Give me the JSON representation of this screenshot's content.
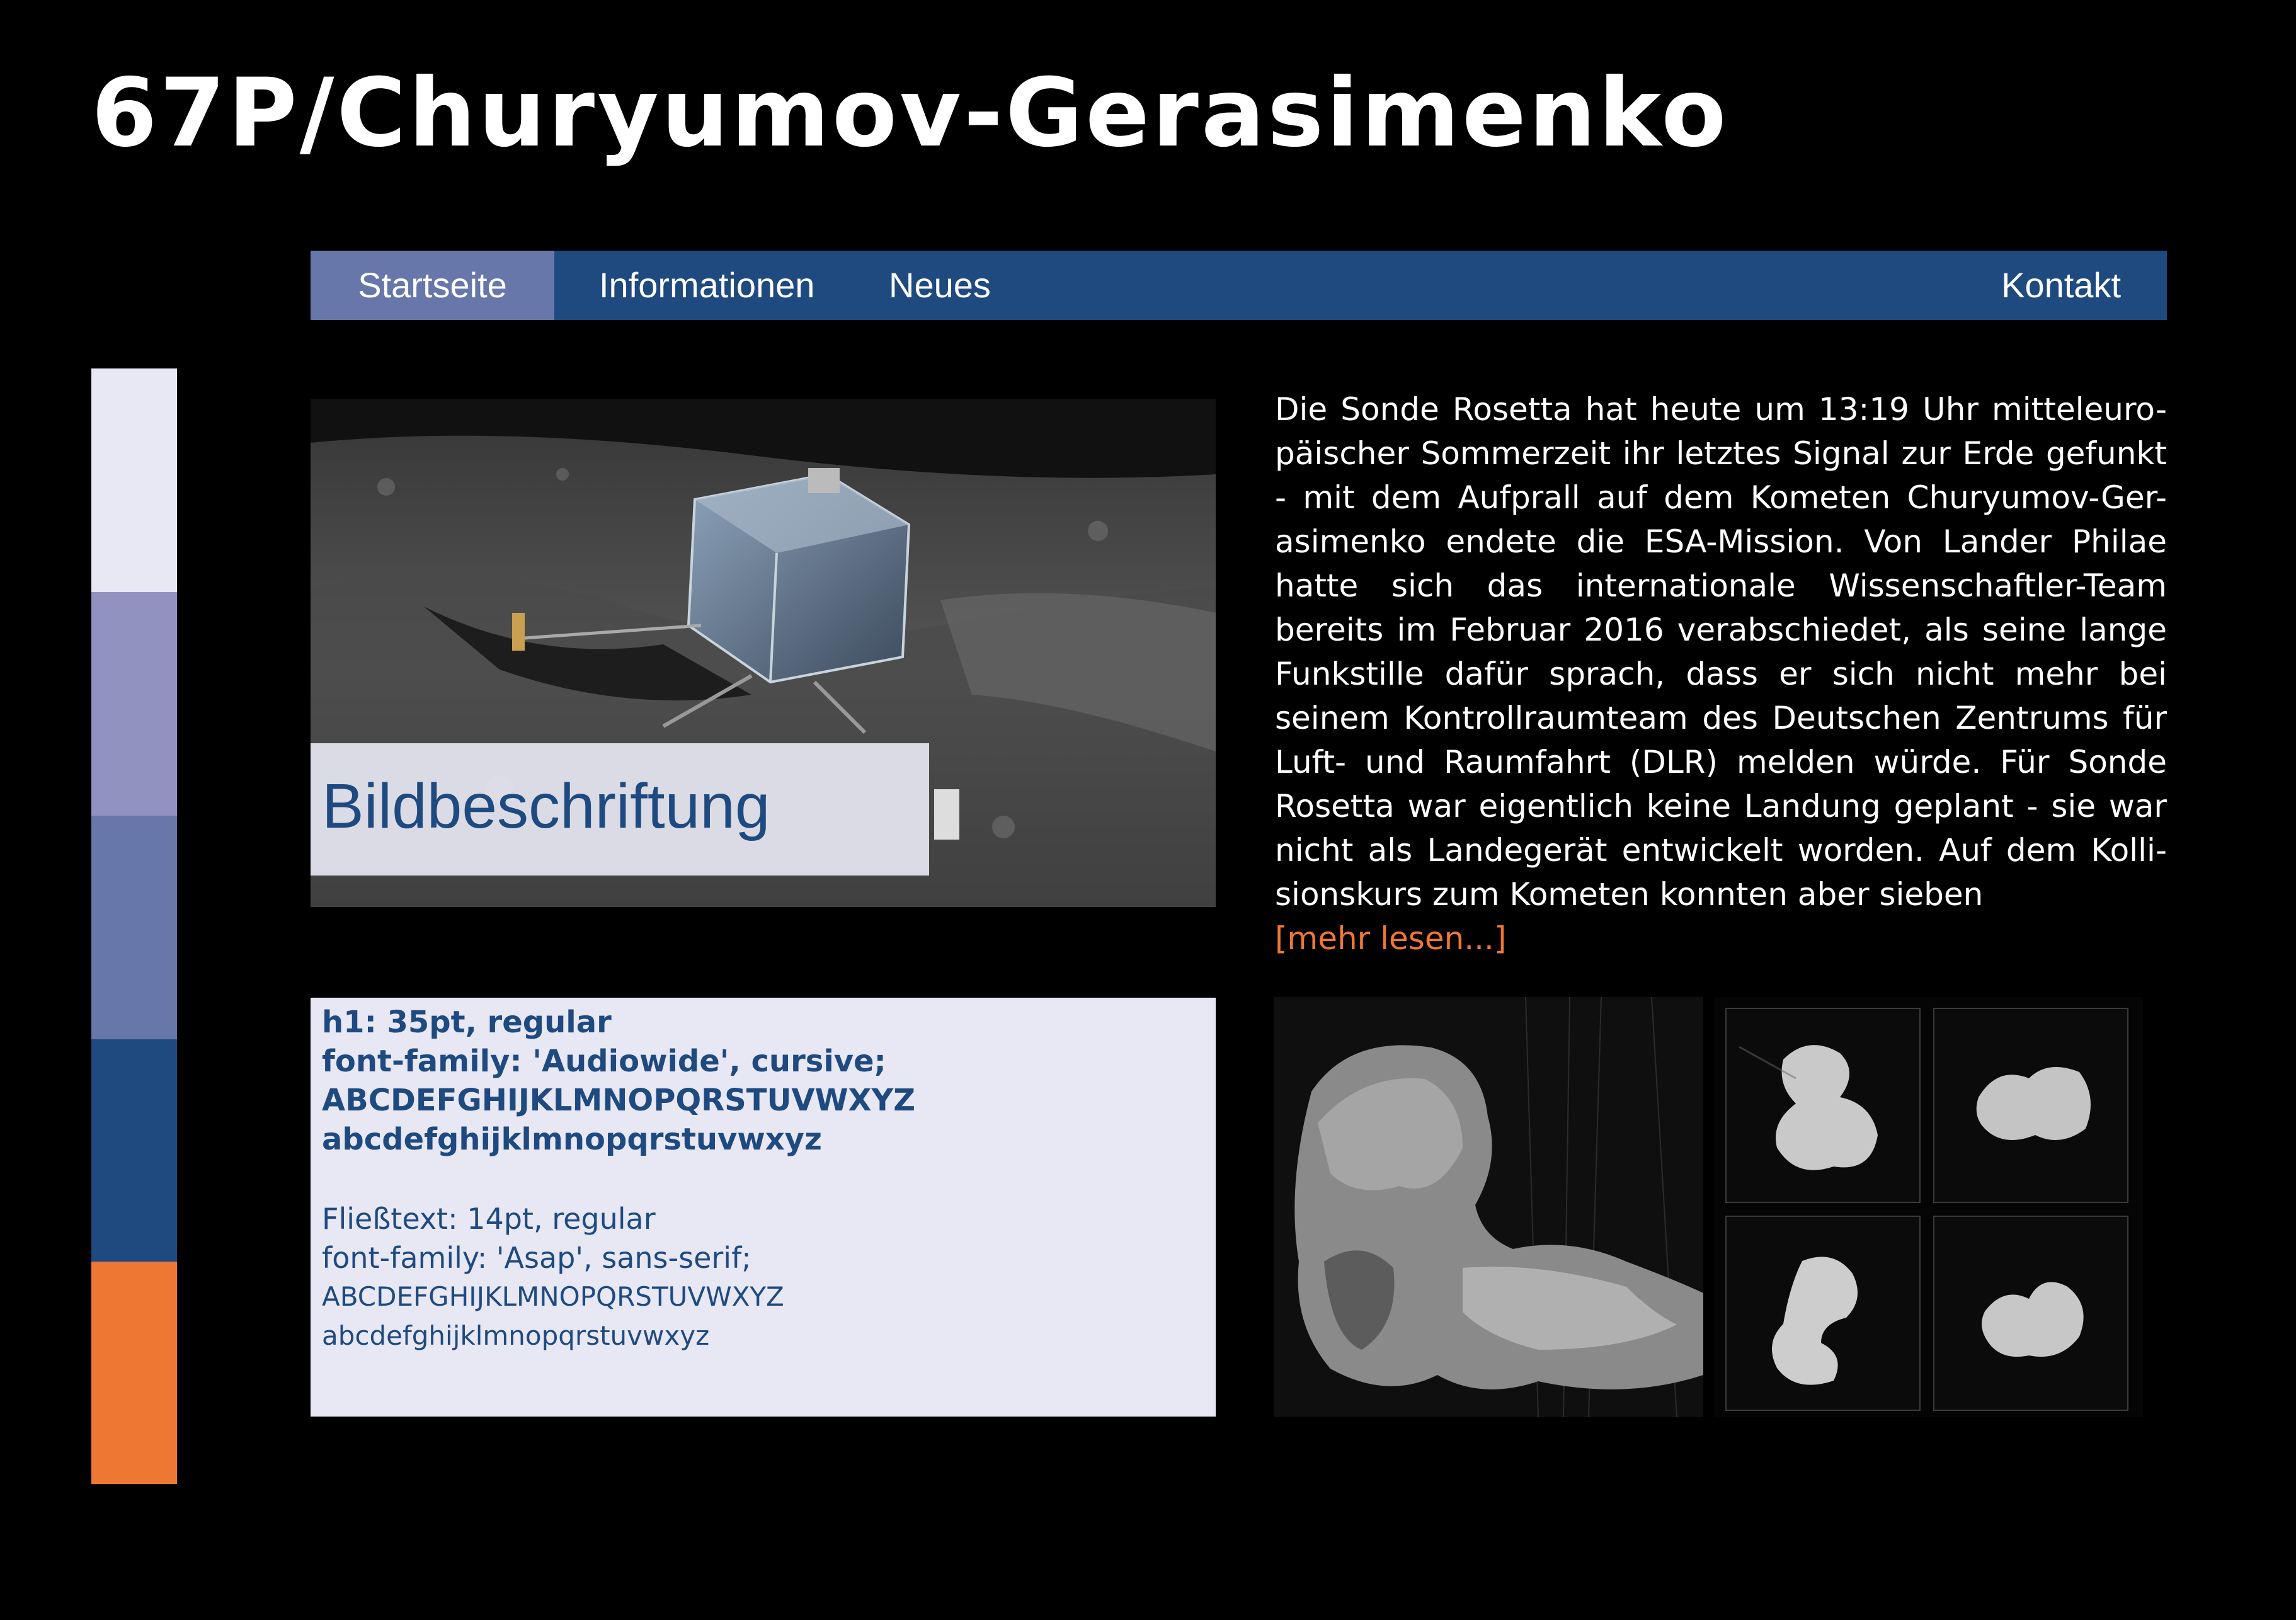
{
  "header": {
    "title": "67P/Churyumov-Gerasimenko"
  },
  "nav": {
    "items": [
      {
        "label": "Startseite",
        "active": true
      },
      {
        "label": "Informationen",
        "active": false
      },
      {
        "label": "Neues",
        "active": false
      },
      {
        "label": "Kontakt",
        "active": false
      }
    ]
  },
  "palette": {
    "colors": [
      "#e8e8f4",
      "#9292c0",
      "#6777aa",
      "#1f4a80",
      "#ee7733"
    ]
  },
  "hero": {
    "image_description": "philae-lander-on-comet-surface",
    "caption": "Bildbeschriftung"
  },
  "article": {
    "lines": [
      "Die Sonde Rosetta hat heute um 13:19 Uhr mitteleuro-",
      "päischer Sommerzeit ihr letztes Signal zur Erde gefunkt",
      "- mit dem Aufprall auf dem Kometen Churyumov-Ger-",
      "asimenko endete die ESA-Mission. Von Lander Philae",
      "hatte sich das internationale Wissenschaftler-Team",
      "bereits im Februar 2016 verabschiedet, als seine lange",
      "Funkstille dafür sprach, dass er sich nicht mehr bei",
      "seinem Kontrollraumteam des Deutschen Zentrums für",
      "Luft- und Raumfahrt (DLR) melden würde. Für Sonde",
      "Rosetta war eigentlich keine Landung geplant - sie war",
      "nicht als Landegerät entwickelt worden. Auf dem Kolli-",
      "sionskurs zum Kometen konnten aber sieben"
    ],
    "read_more": "[mehr lesen...]"
  },
  "typography": {
    "h1_spec": "h1: 35pt, regular",
    "h1_family": "font-family: 'Audiowide', cursive;",
    "h1_upper": "ABCDEFGHIJKLMNOPQRSTUVWXYZ",
    "h1_lower": "abcdefghijklmnopqrstuvwxyz",
    "body_spec": "Fließtext: 14pt, regular",
    "body_family": "font-family: 'Asap', sans-serif;",
    "body_upper": "ABCDEFGHIJKLMNOPQRSTUVWXYZ",
    "body_lower": "abcdefghijklmnopqrstuvwxyz"
  },
  "gallery": {
    "large": "comet-closeup-photo",
    "thumbs": [
      "comet-photo-1",
      "comet-photo-2",
      "comet-photo-3",
      "comet-photo-4"
    ]
  }
}
